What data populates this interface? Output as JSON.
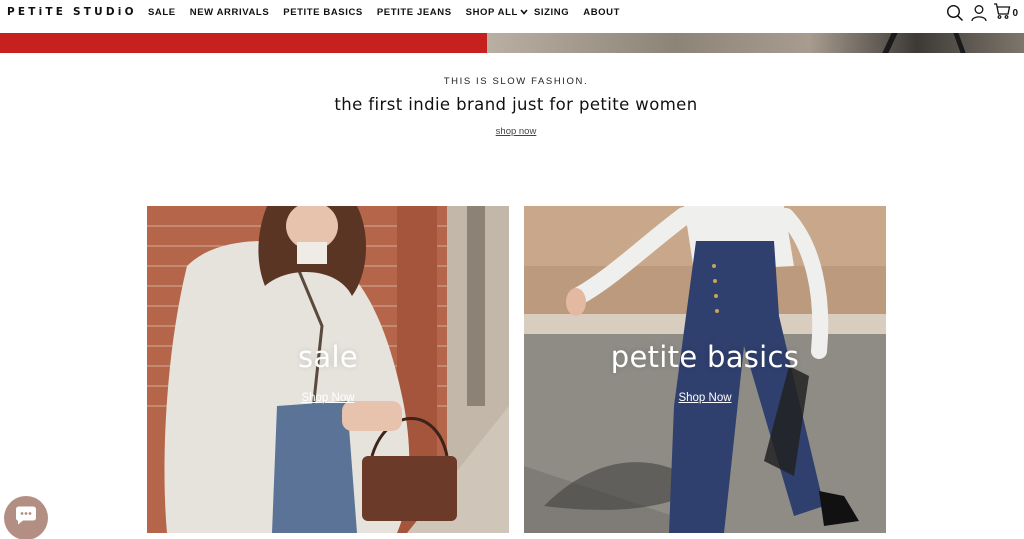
{
  "header": {
    "logo": "PETiTE STUDiO",
    "nav": [
      {
        "label": "SALE"
      },
      {
        "label": "NEW ARRIVALS"
      },
      {
        "label": "PETITE BASICS"
      },
      {
        "label": "PETITE JEANS"
      },
      {
        "label": "SHOP ALL"
      },
      {
        "label": "SIZING"
      },
      {
        "label": "ABOUT"
      }
    ],
    "cart_count": "0"
  },
  "intro": {
    "tagline": "THIS IS SLOW FASHION.",
    "headline": "the first indie brand just for petite women",
    "link": "shop now"
  },
  "cards": [
    {
      "title": "sale",
      "link": "Shop Now"
    },
    {
      "title": "petite basics",
      "link": "Shop Now"
    }
  ],
  "colors": {
    "banner_red": "#c7211f",
    "chat_bubble": "#b38f83",
    "text": "#111111"
  }
}
